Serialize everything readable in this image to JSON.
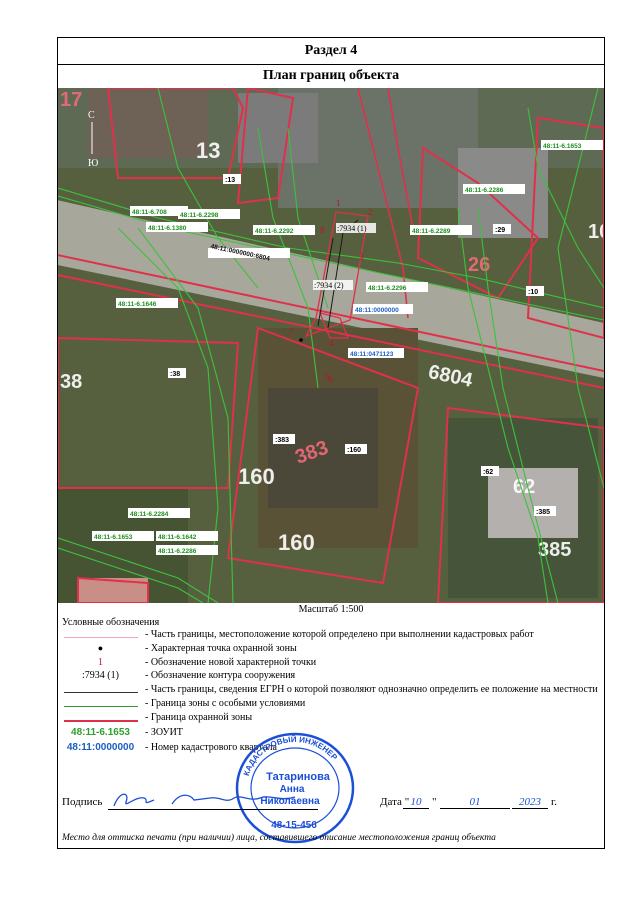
{
  "section_title": "Раздел 4",
  "plan_title": "План границ объекта",
  "scale_text": "Масштаб 1:500",
  "compass": {
    "north": "С",
    "south": "Ю"
  },
  "map_labels": {
    "zouit": [
      "48:11-6.1653",
      "48:11-6.2286",
      "48:11-6.2289",
      "48:11-6.2296",
      "48:11-6.708",
      "48:11-6.2298",
      "48:11-6.1380",
      "48:11-6.2292",
      "48:11-6.1646",
      "48:11-6.2284",
      "48:11-6.1653",
      "48:11-6.1642",
      "48:11-6.2286"
    ],
    "quarters": [
      "48:11:0000000:6804",
      "48:11:0000000",
      "48:11:0471123"
    ],
    "parcels": [
      ":13",
      ":29",
      ":10",
      ":38",
      ":383",
      ":160",
      ":62",
      ":385",
      ":7934 (1)",
      ":7934 (2)"
    ],
    "house_numbers": [
      "17",
      "13",
      "10",
      "26",
      "38",
      "383",
      "160",
      "160",
      "6804",
      "62",
      "385"
    ],
    "points": [
      "1",
      "2",
      "3",
      "4",
      "5",
      "6",
      "7",
      "8"
    ]
  },
  "legend": {
    "title": "Условные обозначения",
    "rows": [
      {
        "symbol": "",
        "text": "- Часть границы, местоположение которой определено при выполнении кадастровых работ"
      },
      {
        "symbol": "●",
        "text": "- Характерная точка охранной зоны"
      },
      {
        "symbol": "1",
        "text": "- Обозначение новой характерной точки"
      },
      {
        "symbol": ":7934 (1)",
        "text": "- Обозначение контура сооружения"
      },
      {
        "symbol": "",
        "text": "- Часть границы, сведения ЕГРН о которой позволяют однозначно определить ее положение на местности"
      },
      {
        "symbol": "",
        "text": "- Граница зоны с особыми условиями"
      },
      {
        "symbol": "",
        "text": "- Граница охранной зоны"
      },
      {
        "symbol": "48:11-6.1653",
        "text": "- ЗОУИТ"
      },
      {
        "symbol": "48:11:0000000",
        "text": "- Номер кадастрового квартала"
      }
    ]
  },
  "signature": {
    "label": "Подпись",
    "date_label": "Дата",
    "day": "10",
    "month": "01",
    "year": "2023",
    "year_suffix": "г."
  },
  "stamp": {
    "ring_text": "КАДАСТРОВЫЙ ИНЖЕНЕР",
    "name_line1": "Татаринова",
    "name_line2": "Анна",
    "name_line3": "Николаевна",
    "number": "48-15-456"
  },
  "footer_note": "Место для оттиска печати (при наличии) лица, составившего описание местоположения границ объекта",
  "colors": {
    "zouit": "#2e9e2e",
    "quarter": "#1d5fc0",
    "security_zone": "#e0304a",
    "new_point": "#c0102a",
    "stamp": "#1b4fd6"
  }
}
